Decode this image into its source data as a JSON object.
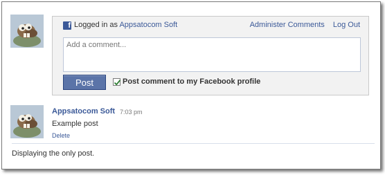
{
  "composer": {
    "logged_in_prefix": "Logged in as",
    "app_name": "Appsatocom Soft",
    "administer_comments": "Administer Comments",
    "log_out": "Log Out",
    "comment_placeholder": "Add a comment...",
    "post_button": "Post",
    "post_to_profile_label": "Post comment to my Facebook profile",
    "post_to_profile_checked": true
  },
  "post": {
    "author": "Appsatocom Soft",
    "time": "7:03 pm",
    "text": "Example post",
    "delete_label": "Delete"
  },
  "footer": {
    "status": "Displaying the only post."
  },
  "colors": {
    "link": "#3b5998",
    "button_bg": "#5b74a8",
    "composer_bg": "#f2f2f2",
    "check_mark": "#2e7d32"
  },
  "icons": {
    "facebook": "facebook-icon",
    "avatar": "avatar"
  }
}
